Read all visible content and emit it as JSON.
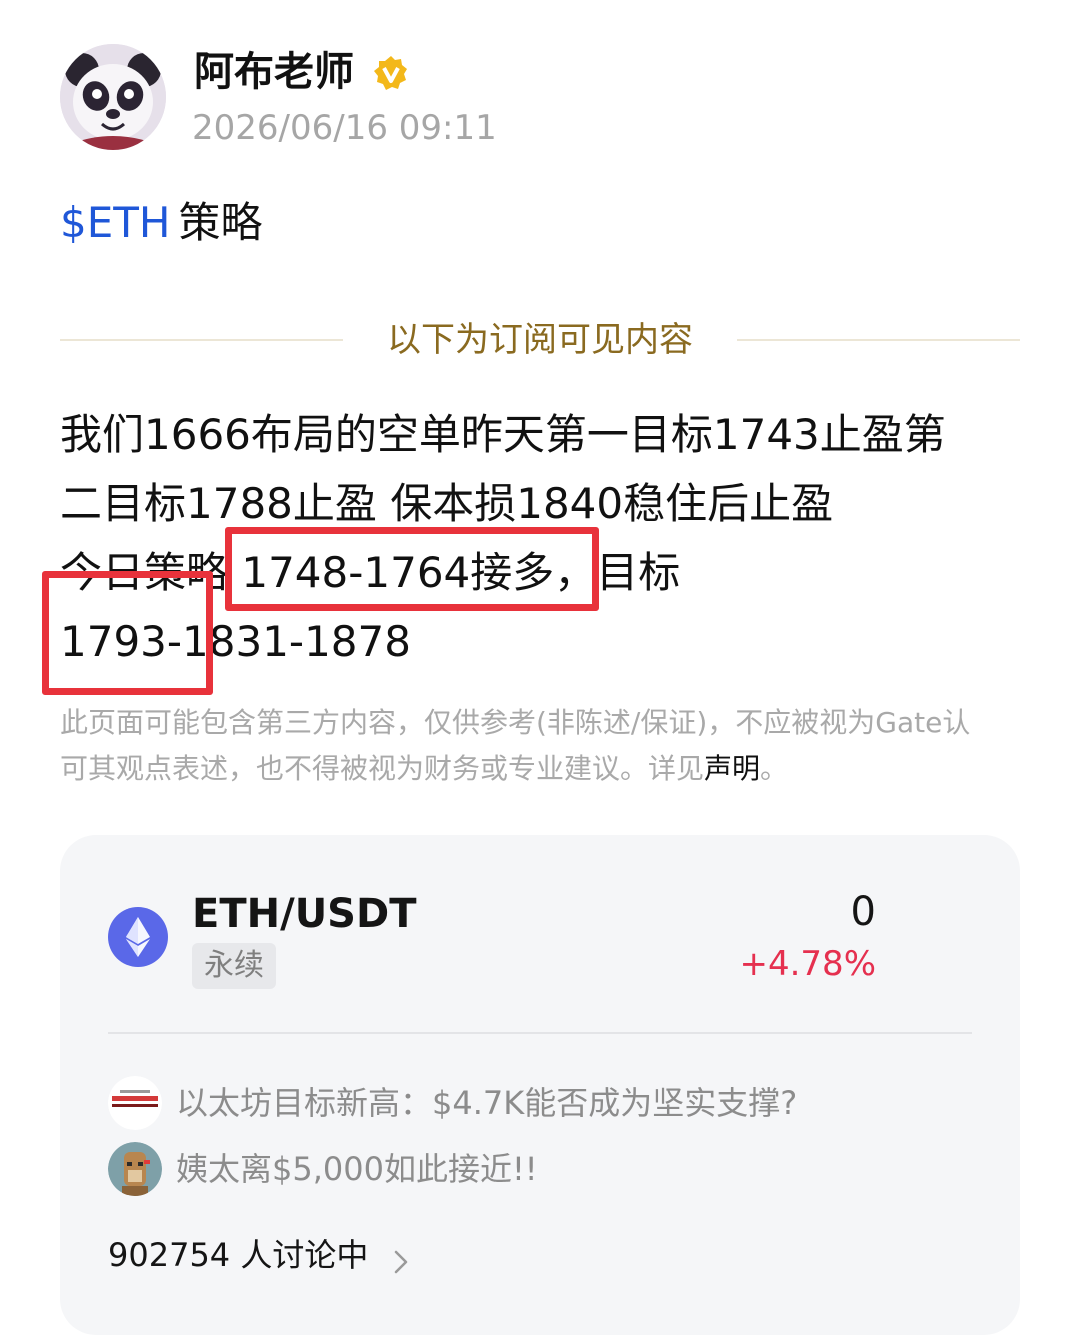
{
  "post": {
    "author": "阿布老师",
    "timestamp": "2026/06/16 09:11",
    "title_ticker": "$ETH",
    "title_text": "策略",
    "subscription_divider": "以下为订阅可见内容",
    "body_lines": [
      "我们1666布局的空单昨天第一目标1743止盈第",
      "二目标1788止盈 保本损1840稳住后止盈",
      "今日策略 1748-1764接多，目标",
      "1793-1831-1878"
    ],
    "disclaimer_lines": [
      "此页面可能包含第三方内容，仅供参考(非陈述/保证)，不应被视为Gate认",
      "可其观点表述，也不得被视为财务或专业建议。详见"
    ],
    "disclaimer_link": "声明",
    "disclaimer_end": "。"
  },
  "market_card": {
    "pair": "ETH/USDT",
    "contract_type": "永续",
    "price": "0",
    "change": "+4.78%",
    "news": [
      {
        "icon": "news-source-icon",
        "text": "以太坊目标新高：$4.7K能否成为坚实支撑?"
      },
      {
        "icon": "ape-avatar-icon",
        "text": "姨太离$5,000如此接近!!"
      }
    ],
    "discussion_count": "902754 人讨论中"
  },
  "colors": {
    "ticker": "#1f57d8",
    "divider_text": "#8a6a20",
    "positive_change": "#e5304f",
    "highlight_box": "#e8323b",
    "verified": "#f3b81a",
    "eth_icon": "#5a68e8"
  }
}
